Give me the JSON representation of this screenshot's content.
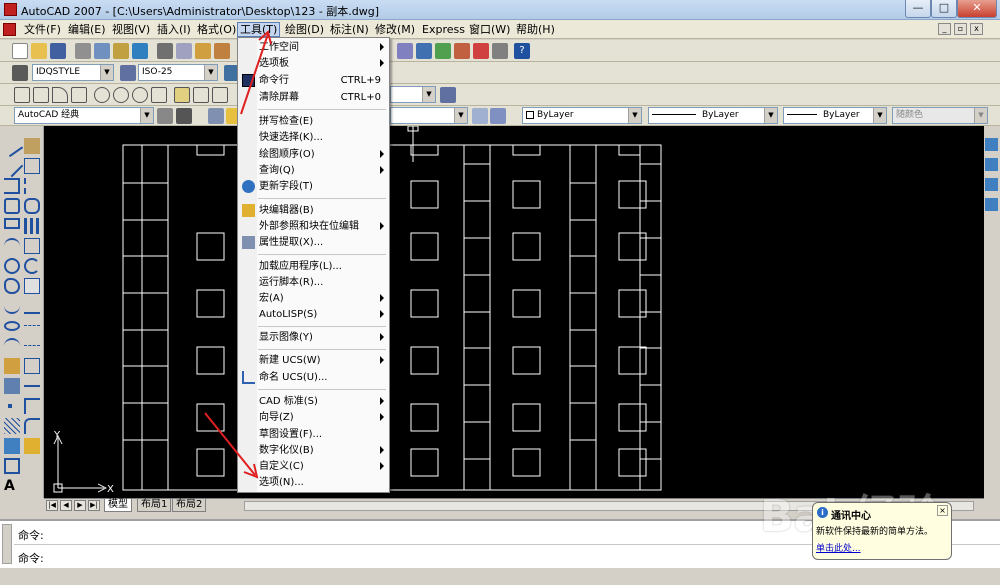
{
  "window": {
    "title": "AutoCAD 2007 - [C:\\Users\\Administrator\\Desktop\\123 - 副本.dwg]",
    "minimize_glyph": "—",
    "maximize_glyph": "□",
    "close_glyph": "✕"
  },
  "menubar": {
    "items": [
      {
        "label": "文件(F)"
      },
      {
        "label": "编辑(E)"
      },
      {
        "label": "视图(V)"
      },
      {
        "label": "插入(I)"
      },
      {
        "label": "格式(O)"
      },
      {
        "label": "工具(T)"
      },
      {
        "label": "绘图(D)"
      },
      {
        "label": "标注(N)"
      },
      {
        "label": "修改(M)"
      },
      {
        "label": "Express"
      },
      {
        "label": "窗口(W)"
      },
      {
        "label": "帮助(H)"
      }
    ]
  },
  "toolbars": {
    "textstyle": "IDQSTYLE",
    "dimstyle": "ISO-25",
    "workspace": "AutoCAD 经典",
    "color": "ByLayer",
    "linetype": "ByLayer",
    "lineweight": "ByLayer",
    "plotstyle": "随颜色"
  },
  "tools_menu": {
    "items": [
      {
        "label": "工作空间",
        "submenu": true
      },
      {
        "label": "选项板",
        "submenu": true
      },
      {
        "label": "命令行",
        "shortcut": "CTRL+9",
        "icon": "command-line-icon"
      },
      {
        "label": "清除屏幕",
        "shortcut": "CTRL+0"
      },
      {
        "separator": true
      },
      {
        "label": "拼写检查(E)"
      },
      {
        "label": "快速选择(K)..."
      },
      {
        "label": "绘图顺序(O)",
        "submenu": true
      },
      {
        "label": "查询(Q)",
        "submenu": true
      },
      {
        "label": "更新字段(T)",
        "icon": "update-fields-icon"
      },
      {
        "separator": true
      },
      {
        "label": "块编辑器(B)",
        "icon": "block-editor-icon"
      },
      {
        "label": "外部参照和块在位编辑",
        "submenu": true
      },
      {
        "label": "属性提取(X)...",
        "icon": "attribute-extract-icon"
      },
      {
        "separator": true
      },
      {
        "label": "加载应用程序(L)..."
      },
      {
        "label": "运行脚本(R)..."
      },
      {
        "label": "宏(A)",
        "submenu": true
      },
      {
        "label": "AutoLISP(S)",
        "submenu": true
      },
      {
        "separator": true
      },
      {
        "label": "显示图像(Y)",
        "submenu": true
      },
      {
        "separator": true
      },
      {
        "label": "新建 UCS(W)",
        "submenu": true
      },
      {
        "label": "命名 UCS(U)...",
        "icon": "named-ucs-icon"
      },
      {
        "separator": true
      },
      {
        "label": "CAD 标准(S)",
        "submenu": true
      },
      {
        "label": "向导(Z)",
        "submenu": true
      },
      {
        "label": "草图设置(F)..."
      },
      {
        "label": "数字化仪(B)",
        "submenu": true
      },
      {
        "label": "自定义(C)",
        "submenu": true
      },
      {
        "label": "选项(N)..."
      }
    ]
  },
  "drawing": {
    "background": "#000000",
    "ucs_y": "Y",
    "ucs_x": "X"
  },
  "layout_tabs": {
    "tabs": [
      {
        "label": "模型",
        "active": true
      },
      {
        "label": "布局1"
      },
      {
        "label": "布局2"
      }
    ]
  },
  "command": {
    "line1": "命令:",
    "line2": "命令:"
  },
  "balloon": {
    "title": "通讯中心",
    "message": "新软件保持最新的简单方法。",
    "link": "单击此处..."
  },
  "watermark": "Bai 经验",
  "annotation_color": "#e02020"
}
